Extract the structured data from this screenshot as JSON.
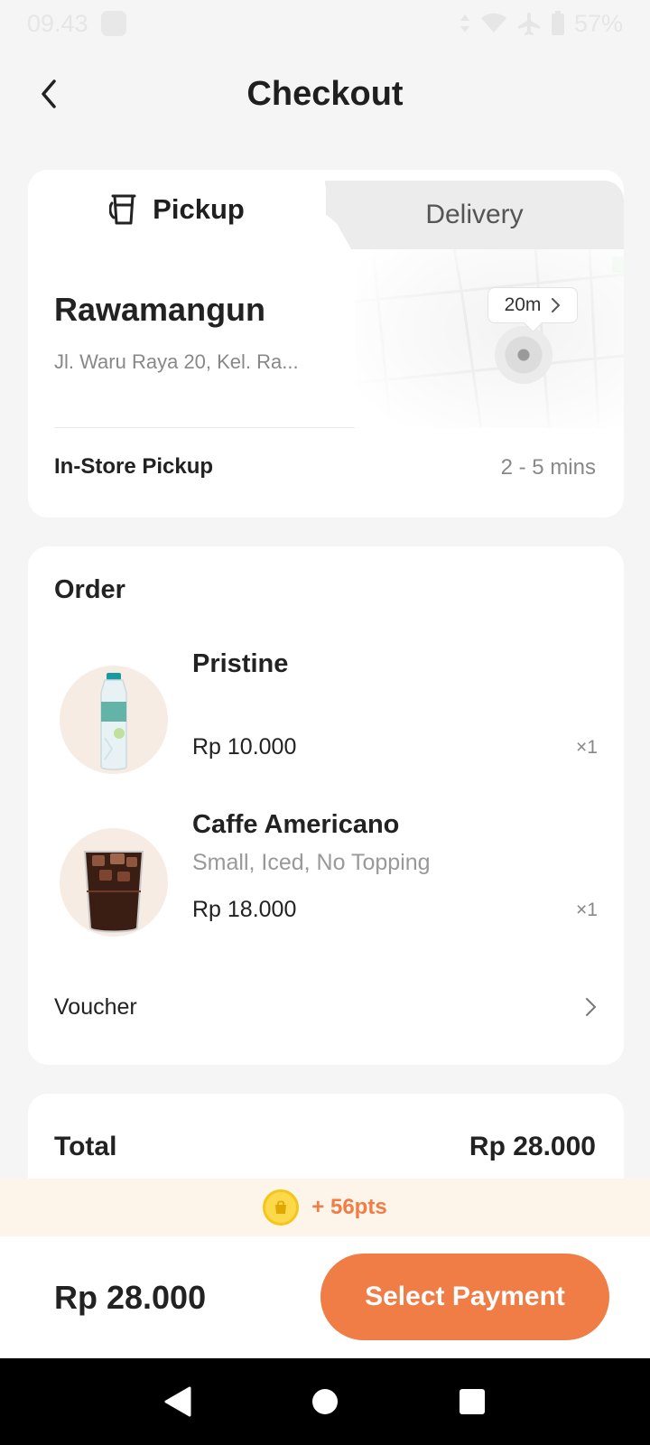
{
  "status_bar": {
    "time": "09.43",
    "battery": "57%"
  },
  "header": {
    "title": "Checkout"
  },
  "mode_tabs": {
    "pickup_label": "Pickup",
    "delivery_label": "Delivery",
    "selected": "Pickup"
  },
  "store": {
    "name": "Rawamangun",
    "address": "Jl. Waru Raya 20, Kel. Ra...",
    "distance": "20m",
    "pickup_type": "In-Store Pickup",
    "pickup_time": "2 - 5 mins"
  },
  "order": {
    "title": "Order",
    "items": [
      {
        "name": "Pristine",
        "options": "",
        "price": "Rp 10.000",
        "qty": "×1"
      },
      {
        "name": "Caffe Americano",
        "options": "Small, Iced, No Topping",
        "price": "Rp 18.000",
        "qty": "×1"
      }
    ],
    "voucher_label": "Voucher"
  },
  "total": {
    "label": "Total",
    "value": "Rp 28.000"
  },
  "points": {
    "text": "+ 56pts"
  },
  "bottom_bar": {
    "total": "Rp 28.000",
    "pay_label": "Select Payment"
  },
  "colors": {
    "accent": "#ef7d45",
    "points_bg": "#fdf4ea",
    "thumb_bg": "#f7ece3"
  }
}
